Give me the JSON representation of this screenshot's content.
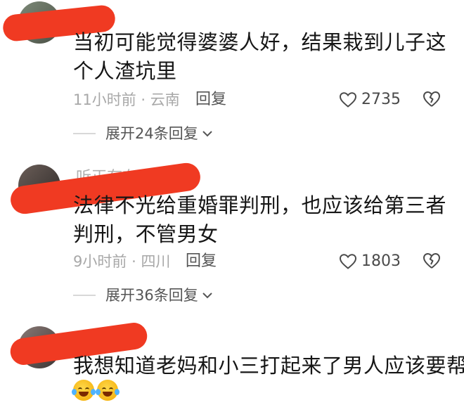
{
  "comments": [
    {
      "username": "",
      "text": "当初可能觉得婆婆人好，结果栽到儿子这个人渣坑里",
      "time": "11小时前",
      "location": "云南",
      "reply_label": "回复",
      "likes": "2735",
      "expand_label": "展开24条回复"
    },
    {
      "username": "听正有在明",
      "text": "法律不光给重婚罪判刑，也应该给第三者判刑，不管男女",
      "time": "9小时前",
      "location": "四川",
      "reply_label": "回复",
      "likes": "1803",
      "expand_label": "展开36条回复"
    },
    {
      "username": "",
      "text": "我想知道老妈和小三打起来了男人应该要帮谁呢",
      "emojis": [
        "laughing-tears-emoji",
        "laughing-tears-emoji"
      ]
    }
  ],
  "meta_separator": "·",
  "icons": {
    "like": "heart-outline-icon",
    "dislike": "broken-heart-outline-icon",
    "expand": "chevron-down-icon"
  },
  "colors": {
    "redaction": "#f03a22",
    "meta_text": "#a8a8a8",
    "body_text": "#161616"
  }
}
